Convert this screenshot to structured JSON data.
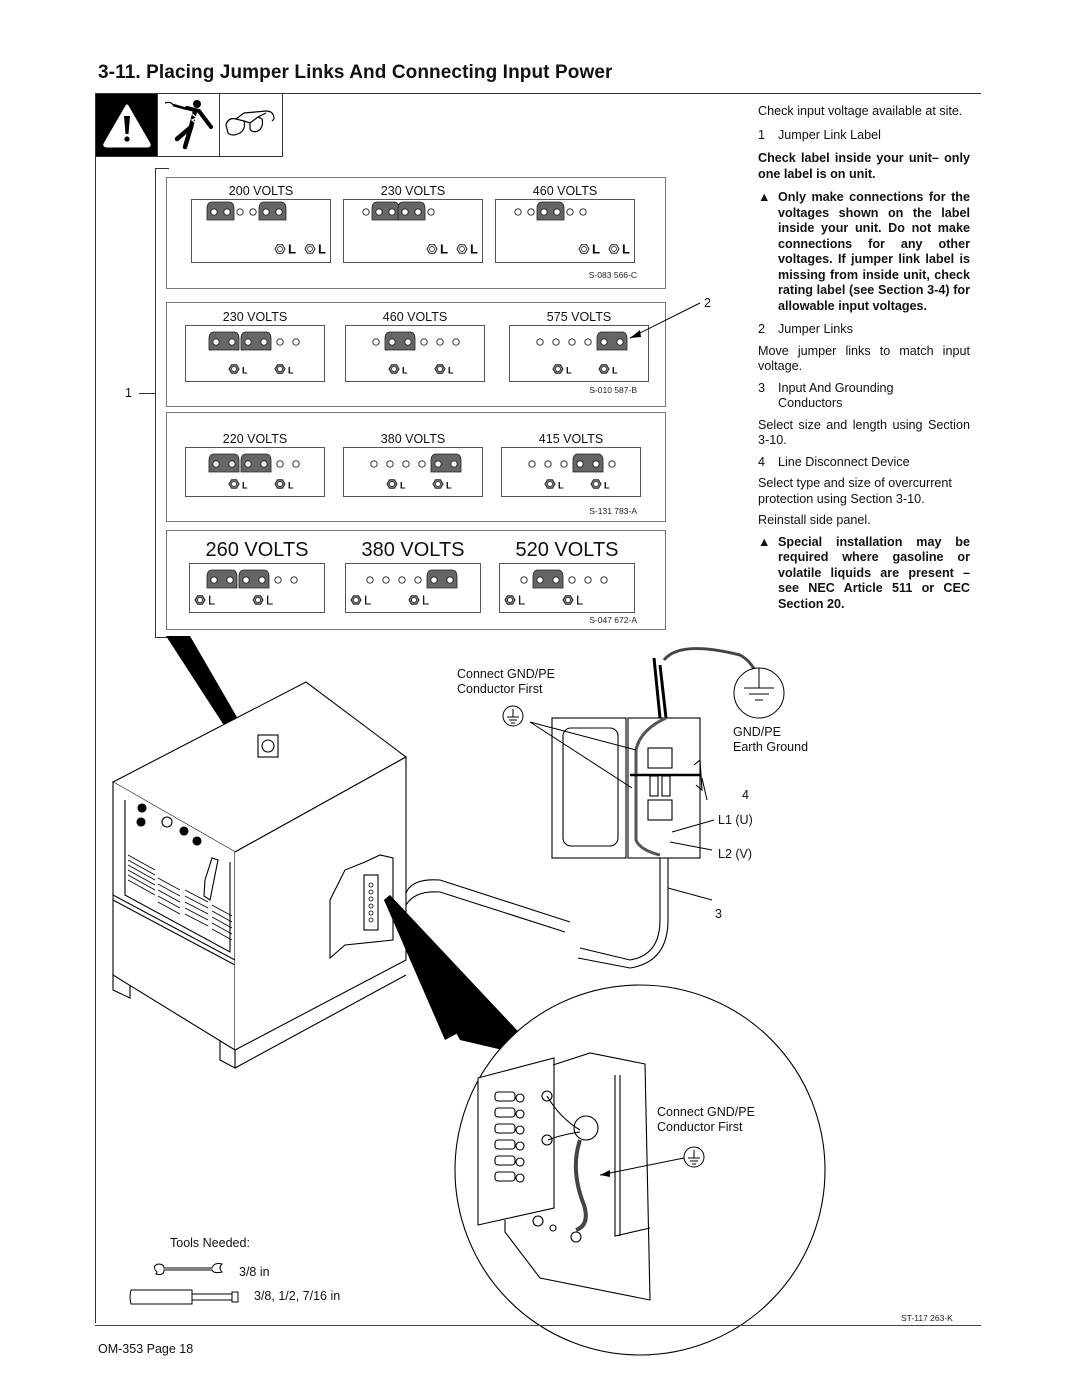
{
  "page": {
    "section_title": "3-11.  Placing Jumper Links And Connecting Input Power",
    "footer": "OM-353 Page 18",
    "drawing_number": "ST-117 263-K"
  },
  "hazard_icons": [
    {
      "name": "warning-icon"
    },
    {
      "name": "electric-shock-icon"
    },
    {
      "name": "safety-glasses-icon"
    }
  ],
  "instructions": {
    "intro": "Check input voltage available at site.",
    "item1": {
      "num": "1",
      "label": "Jumper Link Label"
    },
    "check_label": "Check label  inside your unit– only one label is on unit.",
    "warning1": "Only make connections for the voltages shown on the label inside your unit. Do not make connections for any other voltages. If jumper link label is missing from inside unit, check rating label (see Section 3-4) for allowable input voltages.",
    "item2": {
      "num": "2",
      "label": "Jumper Links"
    },
    "move_links": "Move jumper links to match input voltage.",
    "item3": {
      "num": "3",
      "label": "Input And Grounding Conductors"
    },
    "select_size": "Select size and length using Section 3-10.",
    "item4": {
      "num": "4",
      "label": "Line Disconnect Device"
    },
    "select_type": "Select type and size of overcurrent protection using Section 3-10.",
    "reinstall": "Reinstall side panel.",
    "warning2": "Special installation may be required where gasoline or volatile liquids are present – see NEC Article 511 or CEC Section 20."
  },
  "labels": [
    {
      "part_number": "S-083 566-C",
      "style": "a",
      "voltages": [
        {
          "title": "200 VOLTS",
          "terminals": "LL..LL"
        },
        {
          "title": "230 VOLTS",
          "terminals": ".LLLL."
        },
        {
          "title": "460 VOLTS",
          "terminals": "..LL.."
        }
      ]
    },
    {
      "part_number": "S-010 587-B",
      "style": "b",
      "voltages": [
        {
          "title": "230 VOLTS",
          "terminals": "LLLL.."
        },
        {
          "title": "460 VOLTS",
          "terminals": ".LL..."
        },
        {
          "title": "575 VOLTS",
          "terminals": "....LL"
        }
      ]
    },
    {
      "part_number": "S-131 783-A",
      "style": "b",
      "voltages": [
        {
          "title": "220 VOLTS",
          "terminals": "LLLL.."
        },
        {
          "title": "380 VOLTS",
          "terminals": "....LL"
        },
        {
          "title": "415 VOLTS",
          "terminals": "...LL."
        }
      ]
    },
    {
      "part_number": "S-047 672-A",
      "style": "c",
      "voltages": [
        {
          "title": "260 VOLTS",
          "terminals": "LLLL.."
        },
        {
          "title": "380 VOLTS",
          "terminals": "....LL"
        },
        {
          "title": "520 VOLTS",
          "terminals": ".LL..."
        }
      ]
    }
  ],
  "terminal_letter": "L",
  "callouts": {
    "c1": "1",
    "c2": "2",
    "c3": "3",
    "c4": "4",
    "l1": "L1 (U)",
    "l2": "L2 (V)",
    "gnd_first_top": "Connect  GND/PE\nConductor First",
    "gnd_first_top_l1": "Connect  GND/PE",
    "gnd_first_top_l2": "Conductor First",
    "earth_l1": "GND/PE",
    "earth_l2": "Earth Ground",
    "gnd_first_detail_l1": "Connect  GND/PE",
    "gnd_first_detail_l2": "Conductor First"
  },
  "tools": {
    "heading": "Tools Needed:",
    "wrench": "3/8 in",
    "nutdriver": "3/8, 1/2, 7/16 in"
  }
}
